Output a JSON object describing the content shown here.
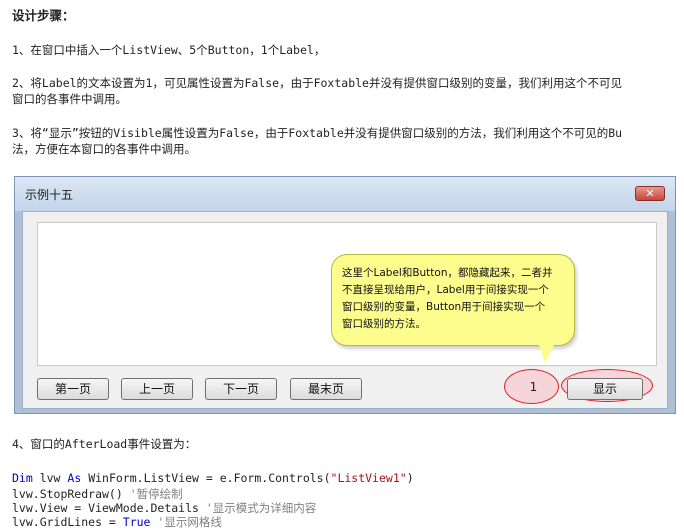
{
  "doc": {
    "heading": "设计步骤：",
    "step1": "1、在窗口中插入一个ListView、5个Button，1个Label，",
    "step2_line1": "2、将Label的文本设置为1，可见属性设置为False，由于Foxtable并没有提供窗口级别的变量，我们利用这个不可见",
    "step2_line2": "窗口的各事件中调用。",
    "step3_line1": "3、将“显示”按钮的Visible属性设置为False，由于Foxtable并没有提供窗口级别的方法，我们利用这个不可见的Bu",
    "step3_line2": "法，方便在本窗口的各事件中调用。",
    "step4": "4、窗口的AfterLoad事件设置为："
  },
  "window": {
    "title": "示例十五",
    "close_glyph": "✕",
    "buttons": {
      "first": "第一页",
      "prev": "上一页",
      "next": "下一页",
      "last": "最末页",
      "show": "显示"
    },
    "label_value": "1",
    "callout": "这里个Label和Button，都隐藏起来，二者并\n不直接呈现给用户，Label用于间接实现一个\n窗口级别的变量，Button用于间接实现一个\n窗口级别的方法。"
  },
  "code": {
    "l1_kw1": "Dim",
    "l1_a": " lvw ",
    "l1_kw2": "As",
    "l1_b": " WinForm.ListView = e.Form.Controls(",
    "l1_str": "\"ListView1\"",
    "l1_c": ")",
    "l2_code": "lvw.StopRedraw() ",
    "l2_comment": "'暂停绘制",
    "l3_code": "lvw.View = ViewMode.Details  ",
    "l3_comment": "'显示模式为详细内容",
    "l4_code": "lvw.GridLines = ",
    "l4_kw": "True",
    "l4_comment": " '显示网格线"
  },
  "colors": {
    "keyword": "#0000cc",
    "string": "#a31515",
    "comment": "#808080",
    "callout_fill": "#fdfd8e",
    "highlight_ring": "#e02020"
  }
}
